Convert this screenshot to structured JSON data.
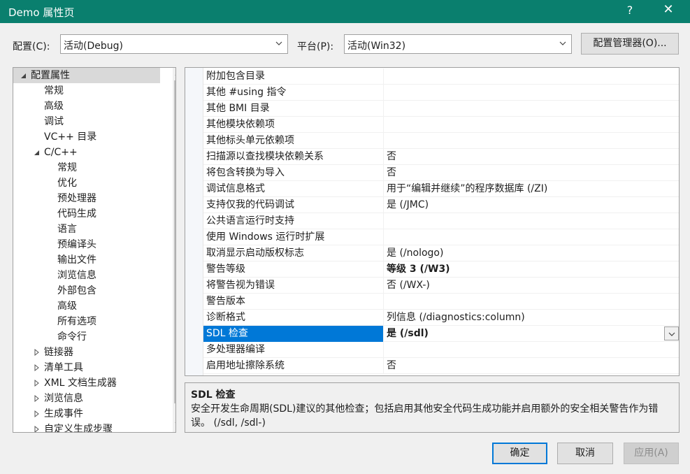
{
  "window": {
    "title": "Demo 属性页",
    "help": "?",
    "close": "✕"
  },
  "toolbar": {
    "config_label": "配置(C):",
    "config_value": "活动(Debug)",
    "platform_label": "平台(P):",
    "platform_value": "活动(Win32)",
    "manager_button": "配置管理器(O)..."
  },
  "tree": {
    "items": [
      {
        "label": "配置属性",
        "expander": "expanded"
      },
      {
        "label": "常规",
        "expander": "none"
      },
      {
        "label": "高级",
        "expander": "none"
      },
      {
        "label": "调试",
        "expander": "none"
      },
      {
        "label": "VC++ 目录",
        "expander": "none"
      },
      {
        "label": "C/C++",
        "expander": "expanded"
      },
      {
        "label": "常规",
        "expander": "none"
      },
      {
        "label": "优化",
        "expander": "none"
      },
      {
        "label": "预处理器",
        "expander": "none"
      },
      {
        "label": "代码生成",
        "expander": "none"
      },
      {
        "label": "语言",
        "expander": "none"
      },
      {
        "label": "预编译头",
        "expander": "none"
      },
      {
        "label": "输出文件",
        "expander": "none"
      },
      {
        "label": "浏览信息",
        "expander": "none"
      },
      {
        "label": "外部包含",
        "expander": "none"
      },
      {
        "label": "高级",
        "expander": "none"
      },
      {
        "label": "所有选项",
        "expander": "none"
      },
      {
        "label": "命令行",
        "expander": "none"
      },
      {
        "label": "链接器",
        "expander": "collapsed"
      },
      {
        "label": "清单工具",
        "expander": "collapsed"
      },
      {
        "label": "XML 文档生成器",
        "expander": "collapsed"
      },
      {
        "label": "浏览信息",
        "expander": "collapsed"
      },
      {
        "label": "生成事件",
        "expander": "collapsed"
      },
      {
        "label": "自定义生成步骤",
        "expander": "collapsed"
      }
    ]
  },
  "grid": {
    "rows": [
      {
        "name": "附加包含目录",
        "value": ""
      },
      {
        "name": "其他 #using 指令",
        "value": ""
      },
      {
        "name": "其他 BMI 目录",
        "value": ""
      },
      {
        "name": "其他模块依赖项",
        "value": ""
      },
      {
        "name": "其他标头单元依赖项",
        "value": ""
      },
      {
        "name": "扫描源以查找模块依赖关系",
        "value": "否"
      },
      {
        "name": "将包含转换为导入",
        "value": "否"
      },
      {
        "name": "调试信息格式",
        "value": "用于“编辑并继续”的程序数据库 (/ZI)"
      },
      {
        "name": "支持仅我的代码调试",
        "value": "是 (/JMC)"
      },
      {
        "name": "公共语言运行时支持",
        "value": ""
      },
      {
        "name": "使用 Windows 运行时扩展",
        "value": ""
      },
      {
        "name": "取消显示启动版权标志",
        "value": "是 (/nologo)"
      },
      {
        "name": "警告等级",
        "value": "等级 3 (/W3)"
      },
      {
        "name": "将警告视为错误",
        "value": "否 (/WX-)"
      },
      {
        "name": "警告版本",
        "value": ""
      },
      {
        "name": "诊断格式",
        "value": "列信息 (/diagnostics:column)"
      },
      {
        "name": "SDL 检查",
        "value": "是 (/sdl)"
      },
      {
        "name": "多处理器编译",
        "value": ""
      },
      {
        "name": "启用地址擦除系统",
        "value": "否"
      }
    ]
  },
  "description": {
    "title": "SDL 检查",
    "text": "安全开发生命周期(SDL)建议的其他检查；包括启用其他安全代码生成功能并启用额外的安全相关警告作为错误。     (/sdl, /sdl-)"
  },
  "buttons": {
    "ok": "确定",
    "cancel": "取消",
    "apply": "应用(A)"
  },
  "colors": {
    "titlebar": "#0a7f6e",
    "selection": "#0078d7",
    "tree_selection": "#d9d9d9"
  }
}
